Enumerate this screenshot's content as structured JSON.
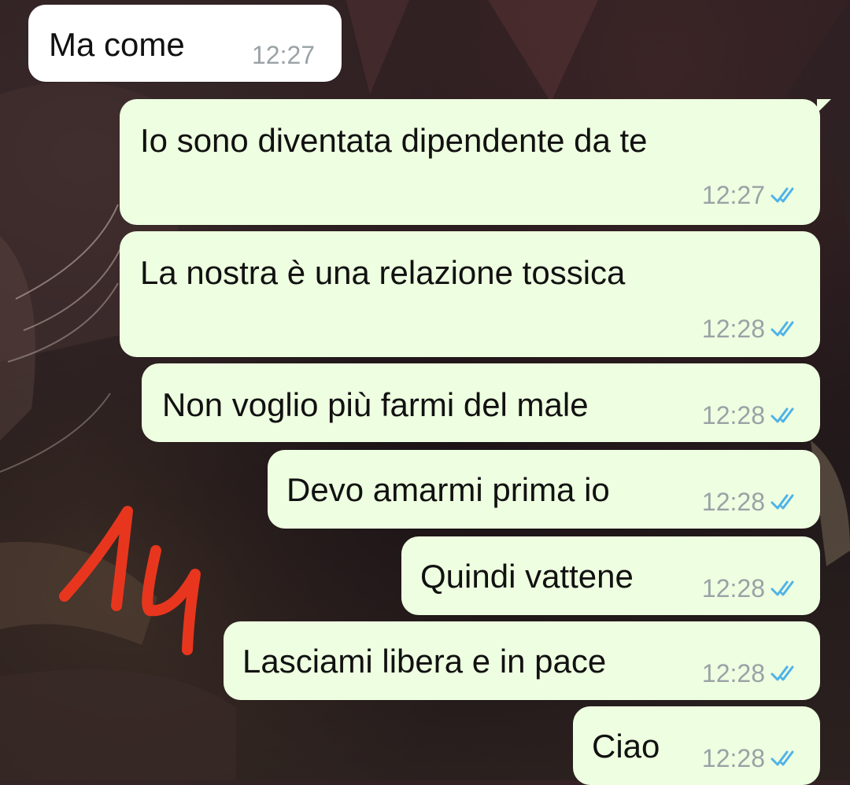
{
  "chat": {
    "messages": [
      {
        "direction": "incoming",
        "text": "Ma come",
        "time": "12:27"
      },
      {
        "direction": "outgoing",
        "text": "Io sono diventata dipendente da te",
        "time": "12:27",
        "status": "read"
      },
      {
        "direction": "outgoing",
        "text": "La nostra è una relazione tossica",
        "time": "12:28",
        "status": "read"
      },
      {
        "direction": "outgoing",
        "text": "Non voglio più farmi del male",
        "time": "12:28",
        "status": "read"
      },
      {
        "direction": "outgoing",
        "text": "Devo amarmi prima io",
        "time": "12:28",
        "status": "read"
      },
      {
        "direction": "outgoing",
        "text": "Quindi vattene",
        "time": "12:28",
        "status": "read"
      },
      {
        "direction": "outgoing",
        "text": "Lasciami libera e in pace",
        "time": "12:28",
        "status": "read"
      },
      {
        "direction": "outgoing",
        "text": "Ciao",
        "time": "12:28",
        "status": "read"
      }
    ]
  },
  "overlay": {
    "handwritten_mark": "14",
    "mark_color": "#e8361e"
  },
  "colors": {
    "incoming_bubble": "#ffffff",
    "outgoing_bubble": "#eefee0",
    "read_tick": "#4fb3e8",
    "timestamp": "#9aa2a6"
  }
}
